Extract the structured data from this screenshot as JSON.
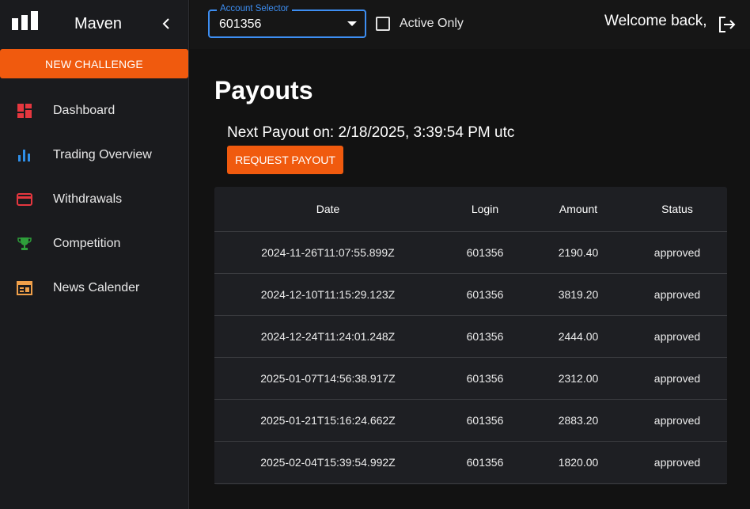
{
  "sidebar": {
    "brand_name": "Maven",
    "new_challenge_label": "New Challenge",
    "items": [
      {
        "label": "Dashboard",
        "icon": "dashboard-icon",
        "color": "#e5373f"
      },
      {
        "label": "Trading Overview",
        "icon": "bar-chart-icon",
        "color": "#2f8fe8"
      },
      {
        "label": "Withdrawals",
        "icon": "credit-card-icon",
        "color": "#e5373f"
      },
      {
        "label": "Competition",
        "icon": "trophy-icon",
        "color": "#2e9e3a"
      },
      {
        "label": "News Calender",
        "icon": "calendar-icon",
        "color": "#f0a04a"
      }
    ]
  },
  "topbar": {
    "account_selector": {
      "label": "Account Selector",
      "value": "601356"
    },
    "active_only_label": "Active Only",
    "active_only_checked": false,
    "welcome_text": "Welcome back,"
  },
  "main": {
    "title": "Payouts",
    "next_payout": "Next Payout on: 2/18/2025, 3:39:54 PM utc",
    "request_payout_label": "Request Payout",
    "table": {
      "headers": [
        "Date",
        "Login",
        "Amount",
        "Status"
      ],
      "rows": [
        [
          "2024-11-26T11:07:55.899Z",
          "601356",
          "2190.40",
          "approved"
        ],
        [
          "2024-12-10T11:15:29.123Z",
          "601356",
          "3819.20",
          "approved"
        ],
        [
          "2024-12-24T11:24:01.248Z",
          "601356",
          "2444.00",
          "approved"
        ],
        [
          "2025-01-07T14:56:38.917Z",
          "601356",
          "2312.00",
          "approved"
        ],
        [
          "2025-01-21T15:16:24.662Z",
          "601356",
          "2883.20",
          "approved"
        ],
        [
          "2025-02-04T15:39:54.992Z",
          "601356",
          "1820.00",
          "approved"
        ]
      ]
    }
  },
  "colors": {
    "accent": "#f05a0e",
    "focus": "#3d8ef2"
  }
}
